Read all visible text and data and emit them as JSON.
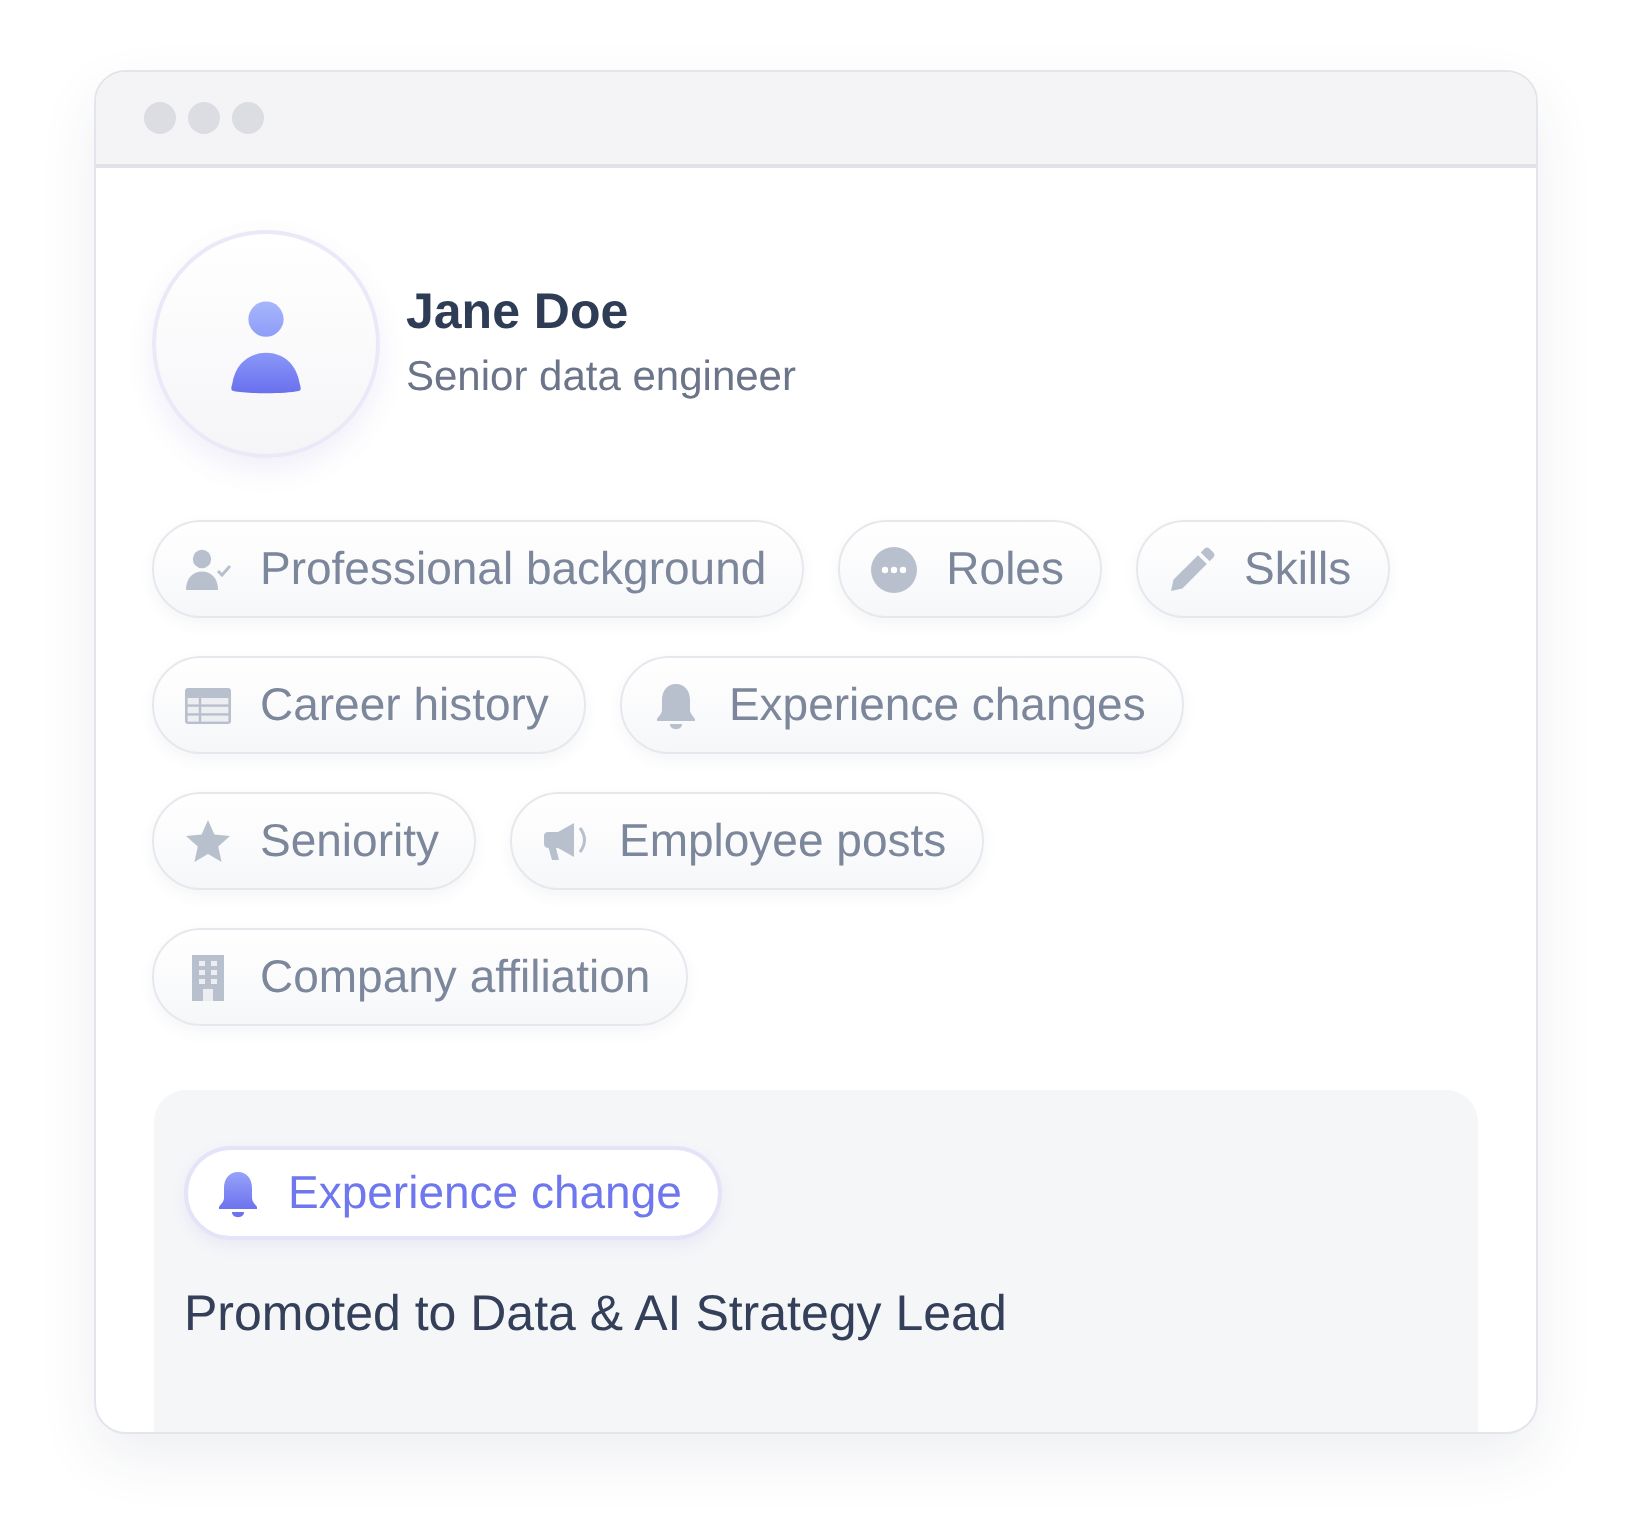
{
  "profile": {
    "name": "Jane Doe",
    "title": "Senior data engineer"
  },
  "chips": [
    {
      "label": "Professional background",
      "kind": "background"
    },
    {
      "label": "Roles",
      "kind": "roles"
    },
    {
      "label": "Skills",
      "kind": "skills"
    },
    {
      "label": "Career history",
      "kind": "history"
    },
    {
      "label": "Experience changes",
      "kind": "changes"
    },
    {
      "label": "Seniority",
      "kind": "seniority"
    },
    {
      "label": "Employee posts",
      "kind": "posts"
    },
    {
      "label": "Company affiliation",
      "kind": "company"
    }
  ],
  "card": {
    "tag": {
      "label": "Experience change",
      "kind": "changes"
    },
    "text": "Promoted to Data & AI Strategy Lead"
  }
}
